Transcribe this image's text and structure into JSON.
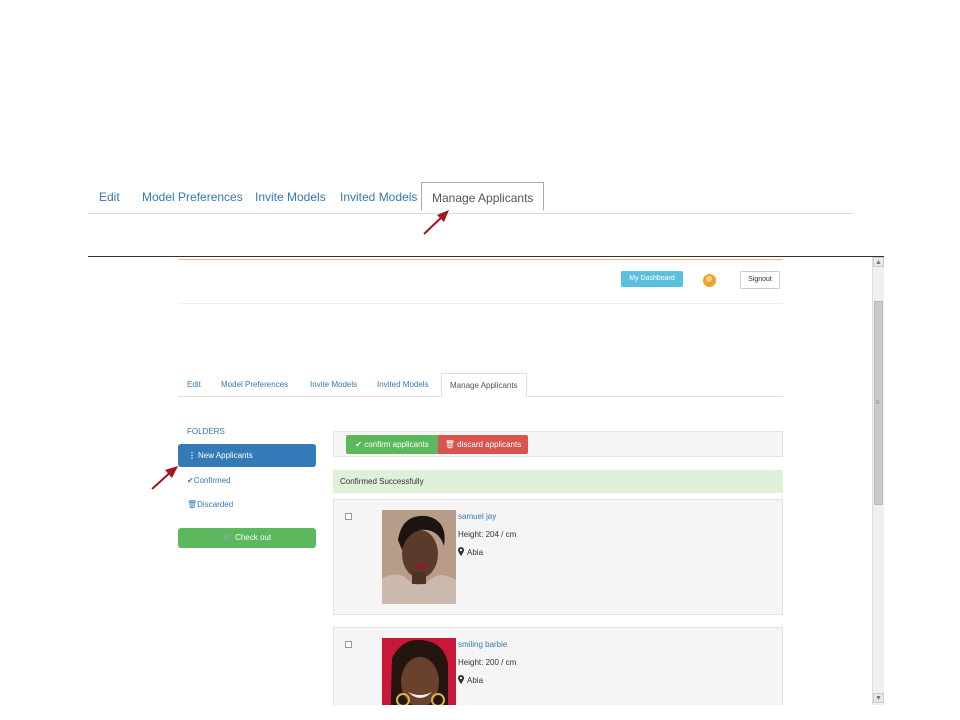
{
  "top_tabs": {
    "items": [
      "Edit",
      "Model Preferences",
      "Invite Models",
      "Invited Models",
      "Manage Applicants"
    ],
    "active": "Manage Applicants"
  },
  "header": {
    "dashboard_label": "My Dashboard",
    "signout_label": "Signout"
  },
  "inner_tabs": {
    "items": [
      "Edit",
      "Model Preferences",
      "Invite Models",
      "Invited Models",
      "Manage Applicants"
    ],
    "active": "Manage Applicants"
  },
  "folders": {
    "heading": "FOLDERS",
    "new_applicants": "New Applicants",
    "confirmed": "Confirmed",
    "discarded": "Discarded",
    "checkout": "Check out"
  },
  "actions": {
    "confirm": "confirm applicants",
    "discard": "discard applicants"
  },
  "alert": "Confirmed Successfully",
  "applicants": [
    {
      "name": "samuel jay",
      "height": "Height: 204 / cm",
      "location": "Abia"
    },
    {
      "name": "smiling barbie",
      "height": "Height: 200 / cm",
      "location": "Abia"
    }
  ],
  "colors": {
    "link": "#337ab7",
    "primary": "#337ab7",
    "success": "#5cb85c",
    "danger": "#d9534f",
    "info": "#5bc0de",
    "alert_bg": "#dff0d8",
    "arrow": "#a3161b"
  }
}
